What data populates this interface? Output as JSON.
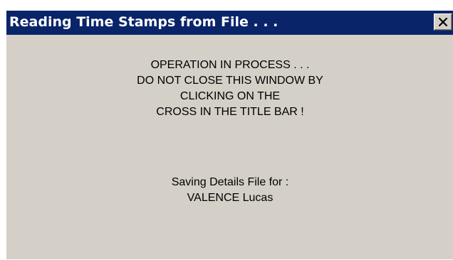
{
  "window": {
    "title": "Reading Time Stamps from File . . .",
    "close_icon": "close-icon"
  },
  "message": {
    "warning_lines": [
      "OPERATION IN PROCESS . . .",
      "DO NOT CLOSE THIS WINDOW BY",
      "CLICKING ON THE",
      "CROSS IN THE TITLE BAR !"
    ],
    "saving_label": "Saving Details File for :",
    "person_name": "VALENCE Lucas"
  },
  "colors": {
    "titlebar": "#0a246a",
    "title_text": "#ffffff",
    "window_bg": "#d4d0c8"
  }
}
